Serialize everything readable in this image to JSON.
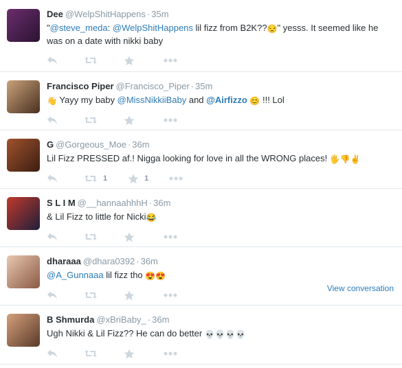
{
  "tweets": [
    {
      "name": "Dee",
      "handle": "@WelpShitHappens",
      "time": "35m",
      "text": [
        {
          "t": "\"",
          "k": "plain"
        },
        {
          "t": "@steve_meda",
          "k": "link"
        },
        {
          "t": ": ",
          "k": "plain"
        },
        {
          "t": "@WelpShitHappens",
          "k": "link"
        },
        {
          "t": " lil fizz from B2K??",
          "k": "plain"
        },
        {
          "t": "😒",
          "k": "emoji"
        },
        {
          "t": "\" yesss. It seemed like he was on a date with nikki baby",
          "k": "plain"
        }
      ],
      "retweets": "",
      "favorites": "",
      "avatar_colors": [
        "#6b2d6e",
        "#2a1430"
      ]
    },
    {
      "name": "Francisco Piper",
      "handle": "@Francisco_Piper",
      "time": "35m",
      "text": [
        {
          "t": "👋",
          "k": "emoji"
        },
        {
          "t": " Yayy my baby ",
          "k": "plain"
        },
        {
          "t": "@MissNikkiiBaby",
          "k": "link"
        },
        {
          "t": " and ",
          "k": "plain"
        },
        {
          "t": "@Airfizzo",
          "k": "linkstrong"
        },
        {
          "t": " ",
          "k": "plain"
        },
        {
          "t": "😊",
          "k": "emoji"
        },
        {
          "t": " !!! Lol",
          "k": "plain"
        }
      ],
      "retweets": "",
      "favorites": "",
      "avatar_colors": [
        "#c8a27a",
        "#4a3020"
      ]
    },
    {
      "name": "G",
      "handle": "@Gorgeous_Moe",
      "time": "36m",
      "text": [
        {
          "t": "Lil Fizz PRESSED af.! Nigga looking for love in all the WRONG places! ",
          "k": "plain"
        },
        {
          "t": "🖐👎✌",
          "k": "emoji"
        }
      ],
      "retweets": "1",
      "favorites": "1",
      "avatar_colors": [
        "#a0522d",
        "#3b1e12"
      ]
    },
    {
      "name": "S L I M",
      "handle": "@__hannaahhhH",
      "time": "36m",
      "text": [
        {
          "t": "& Lil Fizz to little for Nicki",
          "k": "plain"
        },
        {
          "t": "😂",
          "k": "emoji"
        }
      ],
      "retweets": "",
      "favorites": "",
      "avatar_colors": [
        "#c0392b",
        "#1f1f3a"
      ]
    },
    {
      "name": "dharaaa",
      "handle": "@dhara0392",
      "time": "36m",
      "text": [
        {
          "t": "@A_Gunnaaa",
          "k": "link"
        },
        {
          "t": " lil fizz tho ",
          "k": "plain"
        },
        {
          "t": "😍😍",
          "k": "emoji"
        }
      ],
      "retweets": "",
      "favorites": "",
      "view_conversation": "View conversation",
      "avatar_colors": [
        "#e8c7b0",
        "#8a5a44"
      ]
    },
    {
      "name": "B Shmurda",
      "handle": "@xBriBaby_",
      "time": "36m",
      "text": [
        {
          "t": "Ugh Nikki & Lil Fizz?? He can do better ",
          "k": "plain"
        },
        {
          "t": "💀💀💀💀",
          "k": "emoji"
        }
      ],
      "retweets": "",
      "favorites": "",
      "avatar_colors": [
        "#d4a07a",
        "#5a3a2a"
      ]
    }
  ],
  "action_icons": [
    "reply-icon",
    "retweet-icon",
    "favorite-icon",
    "more-icon"
  ],
  "colors": {
    "link": "#2b7bb9",
    "meta": "#8899a6",
    "icon": "#ccd6dd",
    "divider": "#e1e8ed"
  }
}
